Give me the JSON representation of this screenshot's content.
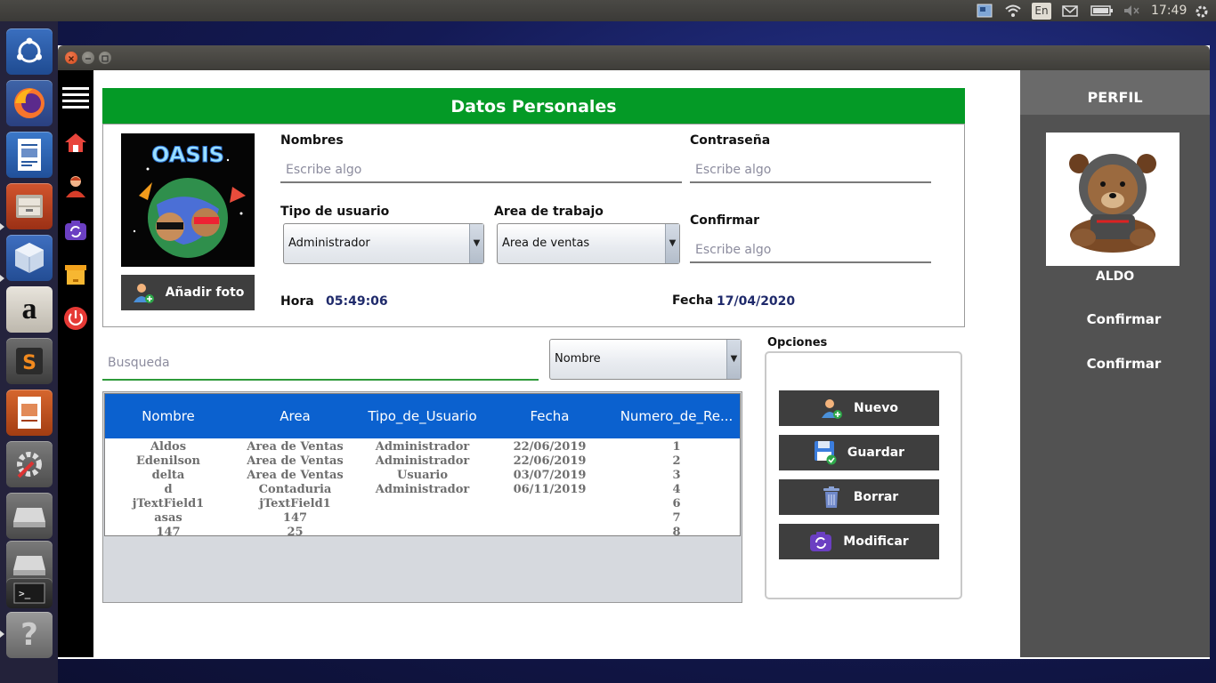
{
  "top_panel": {
    "keyboard": "En",
    "time": "17:49"
  },
  "launcher": {
    "items": [
      "ubuntu-dash-icon",
      "firefox-icon",
      "writer-icon",
      "files-icon",
      "virtualbox-icon",
      "amazon-icon",
      "sublime-icon",
      "impress-icon",
      "settings-icon",
      "drive-icon",
      "drive-icon-2",
      "terminal-icon",
      "help-icon"
    ]
  },
  "sidebar_rail": {
    "items": [
      "menu-icon",
      "home-icon",
      "user-icon",
      "refresh-icon",
      "box-icon",
      "power-icon"
    ]
  },
  "datos": {
    "title": "Datos Personales",
    "add_photo": "Añadir foto",
    "nombres_label": "Nombres",
    "nombres_placeholder": "Escribe algo",
    "contrasena_label": "Contraseña",
    "contrasena_placeholder": "Escribe algo",
    "tipo_label": "Tipo de usuario",
    "tipo_value": "Administrador",
    "area_label": "Area de trabajo",
    "area_value": "Area de ventas",
    "confirmar_label": "Confirmar",
    "confirmar_placeholder": "Escribe algo",
    "hora_label": "Hora",
    "hora_value": "05:49:06",
    "fecha_label": "Fecha",
    "fecha_value": "17/04/2020",
    "photo_text": "OASIS"
  },
  "search": {
    "placeholder": "Busqueda",
    "filter_value": "Nombre"
  },
  "table": {
    "headers": [
      "Nombre",
      "Area",
      "Tipo_de_Usuario",
      "Fecha",
      "Numero_de_Re..."
    ],
    "rows": [
      [
        "Aldos",
        "Area de Ventas",
        "Administrador",
        "22/06/2019",
        "1"
      ],
      [
        "Edenilson",
        "Area de Ventas",
        "Administrador",
        "22/06/2019",
        "2"
      ],
      [
        "delta",
        "Area de Ventas",
        "Usuario",
        "03/07/2019",
        "3"
      ],
      [
        "d",
        "Contaduria",
        "Administrador",
        "06/11/2019",
        "4"
      ],
      [
        "jTextField1",
        "jTextField1",
        "",
        "",
        "6"
      ],
      [
        "asas",
        "147",
        "",
        "",
        "7"
      ],
      [
        "147",
        "25",
        "",
        "",
        "8"
      ]
    ]
  },
  "opciones": {
    "title": "Opciones",
    "nuevo": "Nuevo",
    "guardar": "Guardar",
    "borrar": "Borrar",
    "modificar": "Modificar"
  },
  "perfil": {
    "title": "PERFIL",
    "name": "ALDO",
    "confirm1": "Confirmar",
    "confirm2": "Confirmar"
  }
}
